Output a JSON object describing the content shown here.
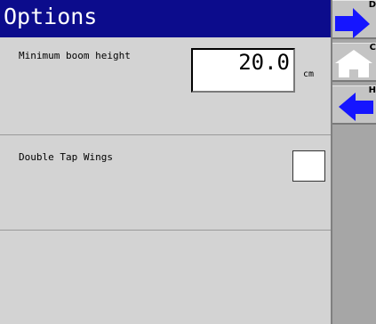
{
  "header": {
    "title": "Options"
  },
  "settings": {
    "boom": {
      "label": "Minimum boom height",
      "value": "20.0",
      "unit": "cm"
    },
    "wings": {
      "label": "Double Tap Wings",
      "checked": false
    }
  },
  "sidebar": {
    "buttons": [
      {
        "icon": "arrow-right-icon",
        "corner_text": "D"
      },
      {
        "icon": "home-icon",
        "corner_text": "C"
      },
      {
        "icon": "arrow-left-icon",
        "corner_text": "H"
      }
    ]
  },
  "colors": {
    "title_bar": "#0c0c8c",
    "arrow_blue": "#1515ff",
    "panel": "#d3d3d3",
    "sidebar": "#a6a6a6"
  }
}
